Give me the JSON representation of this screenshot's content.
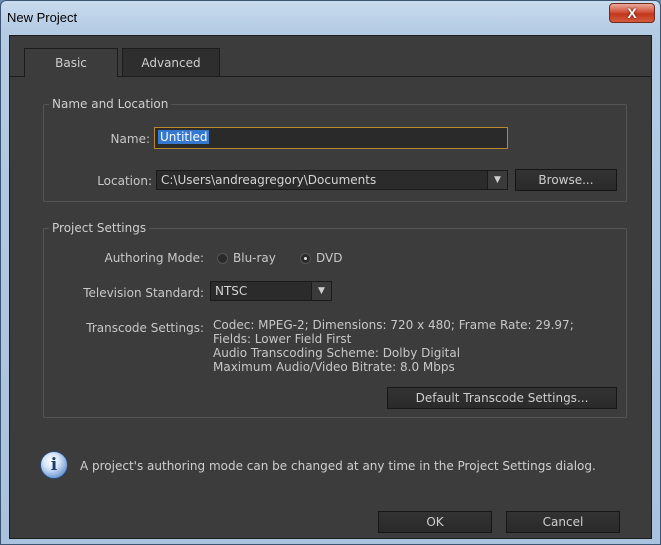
{
  "window": {
    "title": "New Project",
    "close_label": "X"
  },
  "tabs": [
    {
      "label": "Basic",
      "active": true
    },
    {
      "label": "Advanced",
      "active": false
    }
  ],
  "name_location": {
    "group_label": "Name and Location",
    "name_label": "Name:",
    "name_value": "Untitled",
    "location_label": "Location:",
    "location_value": "C:\\Users\\andreagregory\\Documents",
    "browse_label": "Browse..."
  },
  "project_settings": {
    "group_label": "Project Settings",
    "authoring_mode_label": "Authoring Mode:",
    "authoring_options": [
      {
        "label": "Blu-ray",
        "checked": false
      },
      {
        "label": "DVD",
        "checked": true
      }
    ],
    "tv_standard_label": "Television Standard:",
    "tv_standard_value": "NTSC",
    "transcode_label": "Transcode Settings:",
    "transcode_lines": [
      "Codec: MPEG-2; Dimensions: 720 x 480; Frame Rate: 29.97;",
      "Fields: Lower Field First",
      "Audio Transcoding Scheme: Dolby Digital",
      "Maximum Audio/Video Bitrate: 8.0 Mbps"
    ],
    "default_transcode_label": "Default Transcode Settings..."
  },
  "info": {
    "icon": "info-icon",
    "message": "A project's authoring mode can be changed at any time in the Project Settings dialog."
  },
  "footer": {
    "ok_label": "OK",
    "cancel_label": "Cancel"
  }
}
